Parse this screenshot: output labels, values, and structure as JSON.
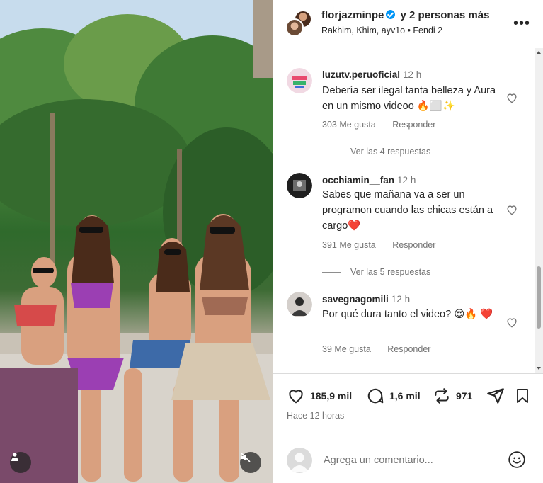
{
  "post": {
    "author": "florjazminpe",
    "coauthors_text": "y 2 personas más",
    "tagged_line": "Rakhim, Khim, ayv1o • Fendi 2",
    "menu_icon": "more-horizontal-icon"
  },
  "comments": [
    {
      "user": "luzutv.peruoficial",
      "time": "12 h",
      "text": "Debería ser ilegal tanta belleza y Aura en un mismo videoo 🔥⬜✨",
      "likes": "303 Me gusta",
      "reply_label": "Responder",
      "replies_label": "Ver las 4 respuestas"
    },
    {
      "user": "occhiamin__fan",
      "time": "12 h",
      "text": "Sabes que mañana va a ser un programon cuando las chicas están a cargo❤️",
      "likes": "391 Me gusta",
      "reply_label": "Responder",
      "replies_label": "Ver las 5 respuestas"
    },
    {
      "user": "savegnagomili",
      "time": "12 h",
      "text": "Por qué dura tanto el video? 😍🔥 ❤️",
      "likes": "39 Me gusta",
      "reply_label": "Responder"
    }
  ],
  "actions": {
    "likes": "185,9 mil",
    "comments": "1,6 mil",
    "reposts": "971",
    "posted_ago": "Hace 12 horas"
  },
  "add_comment": {
    "placeholder": "Agrega un comentario..."
  },
  "colors": {
    "text": "#262626",
    "secondary": "#737373",
    "verified": "#0095f6",
    "heart_red": "#ed4956"
  }
}
